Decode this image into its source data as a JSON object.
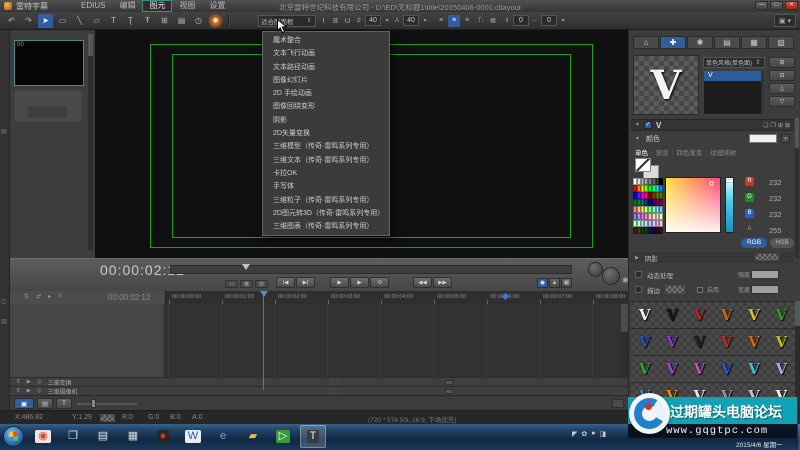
{
  "titlebar": {
    "app_name": "雷特字幕",
    "menus": [
      "EDIUS",
      "编辑",
      "图元",
      "视图",
      "设置"
    ],
    "active_menu": "图元",
    "document_title": "北京雷特世纪科技有限公司 - D:\\ED\\无标题1\\title\\20150406-0001.ctlayout",
    "window_buttons": [
      {
        "name": "minimize-button",
        "glyph": "—"
      },
      {
        "name": "maximize-button",
        "glyph": "□"
      },
      {
        "name": "close-button",
        "glyph": "✕",
        "state": "close"
      }
    ]
  },
  "toolbar": {
    "tools": [
      {
        "name": "undo-button",
        "glyph": "↶"
      },
      {
        "name": "redo-button",
        "glyph": "↷"
      },
      {
        "name": "select-tool",
        "glyph": "➤",
        "state": "selected"
      },
      {
        "name": "rect-tool",
        "glyph": "▭"
      },
      {
        "name": "line-tool",
        "glyph": "╲"
      },
      {
        "name": "skew-rect-tool",
        "glyph": "▱"
      },
      {
        "name": "text-tool",
        "glyph": "T"
      },
      {
        "name": "path-text-tool",
        "glyph": "Ʈ"
      },
      {
        "name": "italic-text-tool",
        "glyph": "Ŧ"
      },
      {
        "name": "frame-tool",
        "glyph": "⊞"
      },
      {
        "name": "image-tool",
        "glyph": "▤"
      },
      {
        "name": "clock-tool",
        "glyph": "◷"
      },
      {
        "name": "effects-tool",
        "glyph": "✸",
        "state": "hover"
      }
    ],
    "fit_dropdown": "适合图面框",
    "style_buttons": [
      {
        "name": "italic-button",
        "glyph": "I"
      },
      {
        "name": "bold-button",
        "glyph": "B"
      },
      {
        "name": "underline-button",
        "glyph": "U"
      }
    ],
    "font_size_1": "40",
    "font_size_2": "40",
    "align_buttons": [
      {
        "name": "align-left-button",
        "glyph": "≡"
      },
      {
        "name": "align-center-button",
        "glyph": "≡",
        "state": "selected"
      },
      {
        "name": "align-right-button",
        "glyph": "≡"
      }
    ],
    "spacing_v": "0",
    "spacing_h": "0"
  },
  "icons": {
    "fit_spinner": "⇕",
    "dropdown_arrow": "▾",
    "rotate": "⇵",
    "lock_size": "A",
    "vertical_text": "T↓",
    "char_width": "▦",
    "v_space": "⇕",
    "h_space": "⇔",
    "preset": "▣",
    "collapse": "▼",
    "expand": "▶",
    "gear": "✱",
    "strip_1": "▤",
    "strip_2": "◫",
    "strip_3": "▥",
    "list_spinner": "⇕"
  },
  "effects_menu": {
    "items": [
      "魔术整合",
      "文本飞行动画",
      "文本路径动画",
      "图像幻灯片",
      "2D 手绘动画",
      "图像回绕变形",
      "阴影",
      "2D矢量变换",
      "三维模型（传奇·雷鸣系列专用）",
      "三维文本（传奇·雷鸣系列专用）",
      "卡拉OK",
      "手写体",
      "三维粒子（传奇·雷鸣系列专用）",
      "2D图元转3D（传奇·雷鸣系列专用）",
      "三维图表（传奇·雷鸣系列专用）"
    ]
  },
  "library": {
    "thumb_label": "00"
  },
  "transport": {
    "timecode": "00:00:02:12",
    "small_buttons": [
      "▭",
      "▦",
      "▨"
    ],
    "step_buttons": [
      "|◀",
      "▶|"
    ],
    "play_buttons": [
      "▶",
      "▶",
      "⟲"
    ],
    "skip_buttons": [
      "◀◀",
      "▶▶"
    ],
    "right_buttons": [
      {
        "name": "preview-toggle-button",
        "glyph": "◉",
        "state": "selected"
      },
      {
        "name": "expand-button",
        "glyph": "▲"
      },
      {
        "name": "grid-toggle-button",
        "glyph": "▦"
      }
    ]
  },
  "timeline": {
    "header_timecode": "00:00:02:12",
    "header_icons": [
      "⇅",
      "⇄",
      "▸",
      "≡"
    ],
    "ruler_labels": [
      "00:00:00:00",
      "00:00:01:00",
      "00:00:02:00",
      "00:00:03:00",
      "00:00:04:00",
      "00:00:05:00",
      "00:00:06:00",
      "00:00:07:00",
      "00:00:08:00"
    ],
    "track_icons": [
      "⇕",
      "▶",
      "◎"
    ],
    "tracks": [
      {
        "name": "三维变换"
      },
      {
        "name": "三维摄像机"
      }
    ],
    "bottom_buttons": [
      {
        "name": "camera-button",
        "glyph": "▣",
        "state": "selected"
      },
      {
        "name": "grid-button",
        "glyph": "▤"
      },
      {
        "name": "text-track-button",
        "glyph": "T"
      }
    ]
  },
  "statusbar": {
    "x": "X:486.82",
    "y": "Y:1.29",
    "r": "R:0",
    "g": "G:0",
    "b": "B:0",
    "a": "A:0",
    "format": "(720 * 576 50i, 16:9, 下场优先)"
  },
  "right_panel": {
    "tabs": [
      {
        "name": "tab-object",
        "glyph": "⌂"
      },
      {
        "name": "tab-style",
        "glyph": "✚",
        "state": "selected"
      },
      {
        "name": "tab-effects",
        "glyph": "✱"
      },
      {
        "name": "tab-library-1",
        "glyph": "▤"
      },
      {
        "name": "tab-library-2",
        "glyph": "▦"
      },
      {
        "name": "tab-library-3",
        "glyph": "▧"
      }
    ],
    "preview_letter": "V",
    "style_dropdown": "单色风格(单色面)",
    "list_selected_item": "V",
    "side_buttons": [
      "⊞",
      "⊟",
      "△",
      "▽"
    ],
    "layer": {
      "letter": "V",
      "check": "✓",
      "icons": [
        "❏",
        "❐",
        "⊞",
        "⊠"
      ]
    },
    "color_section_label": "颜色",
    "color_tabs": [
      "单色",
      "渐变",
      "四色渐变",
      "纹理映射"
    ],
    "active_color_tab": "单色",
    "palette": [
      [
        "#ffffff",
        "#e0e0e0",
        "#c0c0c0",
        "#a0a0a0",
        "#808080",
        "#606060",
        "#404040",
        "#000000"
      ],
      [
        "#ff0000",
        "#ff8000",
        "#ffff00",
        "#80ff00",
        "#00ff00",
        "#00ff80",
        "#00ffff",
        "#0080ff"
      ],
      [
        "#0000ff",
        "#8000ff",
        "#ff00ff",
        "#ff0080",
        "#800000",
        "#804000",
        "#808000",
        "#408000"
      ],
      [
        "#008000",
        "#008040",
        "#008080",
        "#004080",
        "#000080",
        "#400080",
        "#800080",
        "#800040"
      ],
      [
        "#ff8080",
        "#ffc080",
        "#ffff80",
        "#c0ff80",
        "#80ff80",
        "#80ffc0",
        "#80ffff",
        "#80c0ff"
      ],
      [
        "#8080ff",
        "#c080ff",
        "#ff80ff",
        "#ff80c0",
        "#ffc0c0",
        "#ffe0c0",
        "#ffffc0",
        "#e0ffc0"
      ],
      [
        "#c0ffc0",
        "#c0ffe0",
        "#c0ffff",
        "#c0e0ff",
        "#c0c0ff",
        "#e0c0ff",
        "#ffc0ff",
        "#ffc0e0"
      ],
      [
        "#402000",
        "#404000",
        "#204000",
        "#004020",
        "#002040",
        "#200040",
        "#400020",
        "#202020"
      ]
    ],
    "rgba": [
      {
        "label": "R",
        "color": "#c0392b",
        "value": "232"
      },
      {
        "label": "G",
        "color": "#27862c",
        "value": "232"
      },
      {
        "label": "B",
        "color": "#2e5cc5",
        "value": "232"
      },
      {
        "label": "A",
        "color": "",
        "value": "255"
      }
    ],
    "rgb_button": "RGB",
    "hsb_button": "HSB",
    "shadow_label": "阴影",
    "dynamic_label": "动态处理",
    "strength_label": "强度",
    "outline_label": "描边",
    "enable_label": "启用",
    "width_label": "宽度",
    "style_grid": {
      "letter": "V",
      "colors": [
        "#f2f2f2",
        "#161616",
        "#bf2222",
        "#cc6611",
        "#d4c022",
        "#2d9e2d",
        "#2b4fc0",
        "#8a35c9",
        "#222222",
        "#c02a2a",
        "#d06a18",
        "#c6b61a",
        "#34a034",
        "#9a46ca",
        "#c94ac9",
        "#3553d2",
        "#46bada",
        "#b9a0e8",
        "#5b7aa9",
        "#d88c1c",
        "#e9e9e9",
        "#979797",
        "#cccccc",
        "#f5f5f5",
        "#c9b832",
        "#e2e2e2",
        "#3a3a3a",
        "#84603e",
        "#c9862e",
        "#8f8f8f"
      ]
    }
  },
  "watermark": {
    "title": "过期罐头电脑论坛",
    "url": "www.gqgtpc.com"
  },
  "taskbar": {
    "icons": [
      {
        "name": "taskbar-app-orange",
        "glyph": "◉",
        "color": "#d84830",
        "bg": "#f0e8e0"
      },
      {
        "name": "taskbar-remote-desktop",
        "glyph": "❐",
        "color": "#cfe4f4",
        "bg": ""
      },
      {
        "name": "taskbar-notepad",
        "glyph": "▤",
        "color": "#e8e8f0",
        "bg": ""
      },
      {
        "name": "taskbar-grid-app",
        "glyph": "▦",
        "color": "#dddddd",
        "bg": ""
      },
      {
        "name": "taskbar-recorder",
        "glyph": "●",
        "color": "#d03030",
        "bg": "#282828"
      },
      {
        "name": "taskbar-word",
        "glyph": "W",
        "color": "#2b5797",
        "bg": "#e8eef8"
      },
      {
        "name": "taskbar-internet-explorer",
        "glyph": "e",
        "color": "#55b0e8",
        "bg": ""
      },
      {
        "name": "taskbar-folder",
        "glyph": "▰",
        "color": "#e8b955",
        "bg": ""
      },
      {
        "name": "taskbar-media-green",
        "glyph": "▷",
        "color": "#ffffff",
        "bg": "#3a9a3a"
      },
      {
        "name": "taskbar-title-app",
        "glyph": "T",
        "color": "#eeeeee",
        "bg": "#3a3a44",
        "state": "active"
      }
    ],
    "tray_icons": [
      "◤",
      "✿",
      "●",
      "◨"
    ],
    "date_text": "2015/4/6 星期一"
  }
}
